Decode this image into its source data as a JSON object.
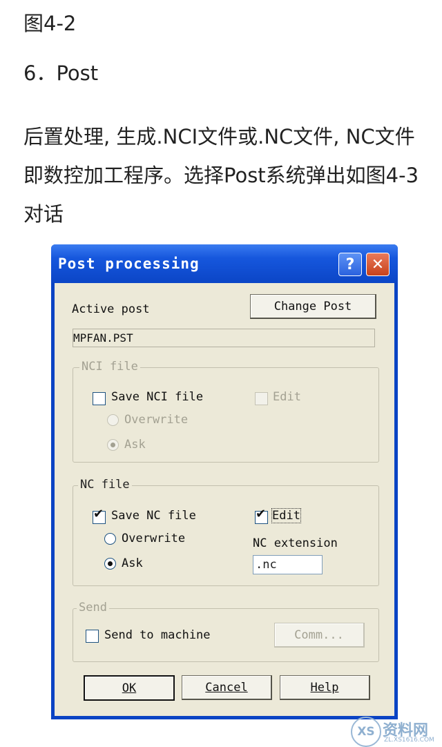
{
  "doc": {
    "figure_caption": "图4-2",
    "section_heading": "6．Post",
    "paragraph": "后置处理, 生成.NCI文件或.NC文件, NC文件即数控加工程序。选择Post系统弹出如图4-3对话"
  },
  "dialog": {
    "title": "Post processing",
    "help_glyph": "?",
    "close_glyph": "✕",
    "active_post_label": "Active post",
    "change_post_label": "Change Post",
    "active_post_value": "MPFAN.PST",
    "nci_group": {
      "label": "NCI file",
      "save_label": "Save NCI file",
      "save_checked": false,
      "edit_label": "Edit",
      "edit_checked": false,
      "overwrite_label": "Overwrite",
      "ask_label": "Ask",
      "selected": "Ask",
      "enabled": false
    },
    "nc_group": {
      "label": "NC file",
      "save_label": "Save NC file",
      "save_checked": true,
      "edit_label": "Edit",
      "edit_checked": true,
      "overwrite_label": "Overwrite",
      "ask_label": "Ask",
      "selected": "Ask",
      "extension_label": "NC extension",
      "extension_value": ".nc"
    },
    "send_group": {
      "label": "Send",
      "send_label": "Send to machine",
      "send_checked": false,
      "comm_label": "Comm...",
      "enabled": false
    },
    "ok_label": "OK",
    "cancel_label": "Cancel",
    "help_label": "Help"
  },
  "watermark": {
    "logo_text": "XS",
    "text": "资料网",
    "subtext": "ZL.XS1616.COM"
  },
  "colors": {
    "titlebar": "#0b45c6",
    "dialog_face": "#ece9d8",
    "disabled_text": "#a3a192"
  },
  "icons": [
    "help-icon",
    "close-icon",
    "checkmark-icon",
    "radio-dot-icon"
  ]
}
